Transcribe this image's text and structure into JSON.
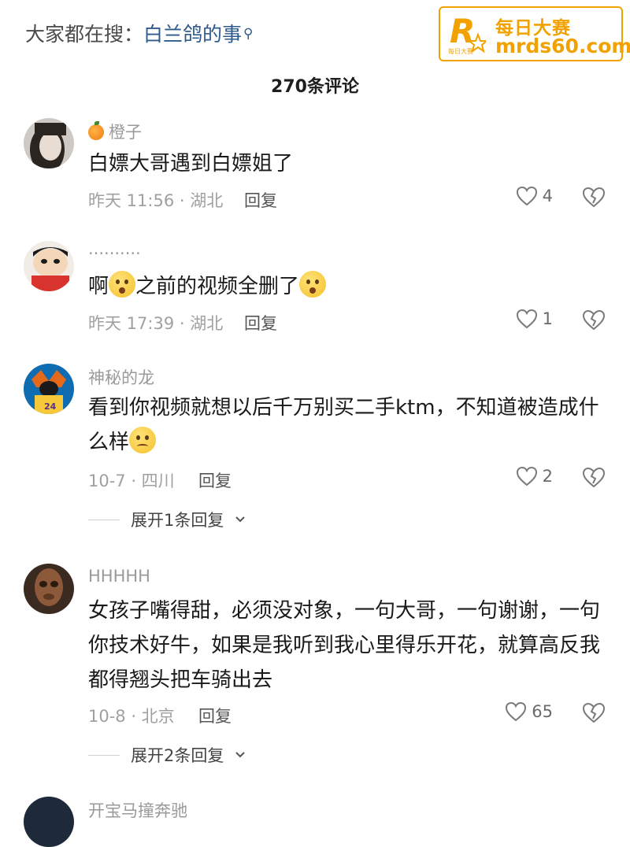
{
  "search": {
    "prefix": "大家都在搜：",
    "query": "白兰鸽的事",
    "icon": "search-icon"
  },
  "watermark": {
    "line1": "每日大赛",
    "line2": "mrds60.com",
    "logo_letter": "R",
    "logo_small": "每日大赛",
    "color": "#f2a200"
  },
  "header": {
    "comment_count": "270条评论"
  },
  "comments": [
    {
      "username": "橙子",
      "username_emoji": "orange-emoji",
      "text": "白嫖大哥遇到白嫖姐了",
      "meta": "昨天 11:56 · 湖北",
      "reply": "回复",
      "likes": "4"
    },
    {
      "username": "··········",
      "text_a": "啊",
      "text_b": "之前的视频全删了",
      "meta": "昨天 17:39 · 湖北",
      "reply": "回复",
      "likes": "1"
    },
    {
      "username": "神秘的龙",
      "text": "看到你视频就想以后千万别买二手ktm，不知道被造成什么样",
      "meta": "10-7 · 四川",
      "reply": "回复",
      "likes": "2",
      "expand": "展开1条回复"
    },
    {
      "username": "HHHHH",
      "text": "女孩子嘴得甜，必须没对象，一句大哥，一句谢谢，一句你技术好牛，如果是我听到我心里得乐开花，就算高反我都得翘头把车骑出去",
      "meta": "10-8 · 北京",
      "reply": "回复",
      "likes": "65",
      "expand": "展开2条回复"
    },
    {
      "username": "开宝马撞奔驰"
    }
  ],
  "colors": {
    "link": "#2f5a8c",
    "muted": "#a0a0a0",
    "text": "#1a1a1a"
  }
}
